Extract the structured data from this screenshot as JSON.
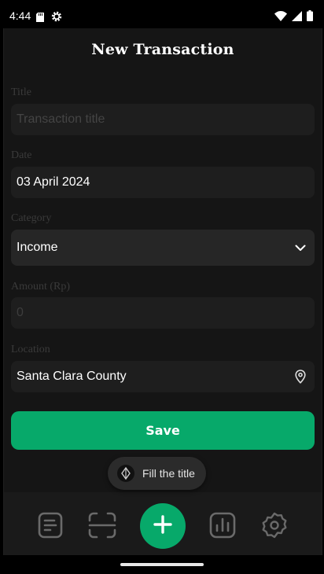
{
  "status_bar": {
    "time": "4:44",
    "icons": [
      "sd-card-icon",
      "settings-gear-icon",
      "wifi-icon",
      "signal-icon",
      "battery-icon"
    ]
  },
  "header": {
    "title": "New Transaction"
  },
  "form": {
    "title": {
      "label": "Title",
      "placeholder": "Transaction title",
      "value": ""
    },
    "date": {
      "label": "Date",
      "value": "03 April 2024"
    },
    "category": {
      "label": "Category",
      "value": "Income",
      "icon": "chevron-down-icon"
    },
    "amount": {
      "label": "Amount (Rp)",
      "value": "0"
    },
    "location": {
      "label": "Location",
      "value": "Santa Clara County",
      "icon": "location-pin-icon"
    }
  },
  "save_button": {
    "label": "Save"
  },
  "bottom_nav": {
    "items": [
      "transactions-icon",
      "scan-icon",
      "add-icon",
      "chart-icon",
      "settings-icon"
    ]
  },
  "toast": {
    "text": "Fill the title"
  },
  "colors": {
    "accent": "#07a96a",
    "background": "#151515",
    "field": "#1e1e1e",
    "label": "#3a3a3a"
  }
}
